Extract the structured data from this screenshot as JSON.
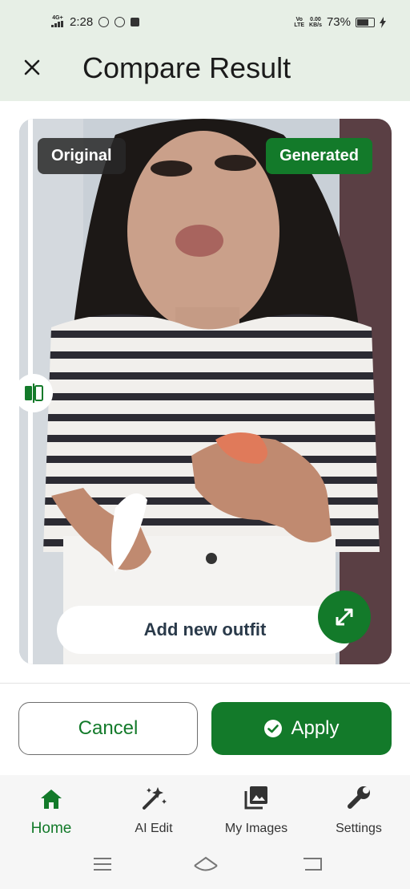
{
  "status_bar": {
    "network_top": "4G+",
    "time": "2:28",
    "volte": "Vo",
    "lte": "LTE",
    "speed_value": "0.00",
    "speed_unit": "KB/s",
    "battery": "73%"
  },
  "header": {
    "title": "Compare Result"
  },
  "compare": {
    "original_label": "Original",
    "generated_label": "Generated",
    "add_outfit_label": "Add new outfit"
  },
  "actions": {
    "cancel_label": "Cancel",
    "apply_label": "Apply"
  },
  "bottom_nav": {
    "items": [
      {
        "label": "Home",
        "icon": "home-icon"
      },
      {
        "label": "AI Edit",
        "icon": "magic-wand-icon"
      },
      {
        "label": "My Images",
        "icon": "gallery-icon"
      },
      {
        "label": "Settings",
        "icon": "wrench-icon"
      }
    ]
  },
  "colors": {
    "accent": "#137a2a",
    "header_bg": "#e7efe6",
    "nav_bg": "#f6f6f6"
  }
}
